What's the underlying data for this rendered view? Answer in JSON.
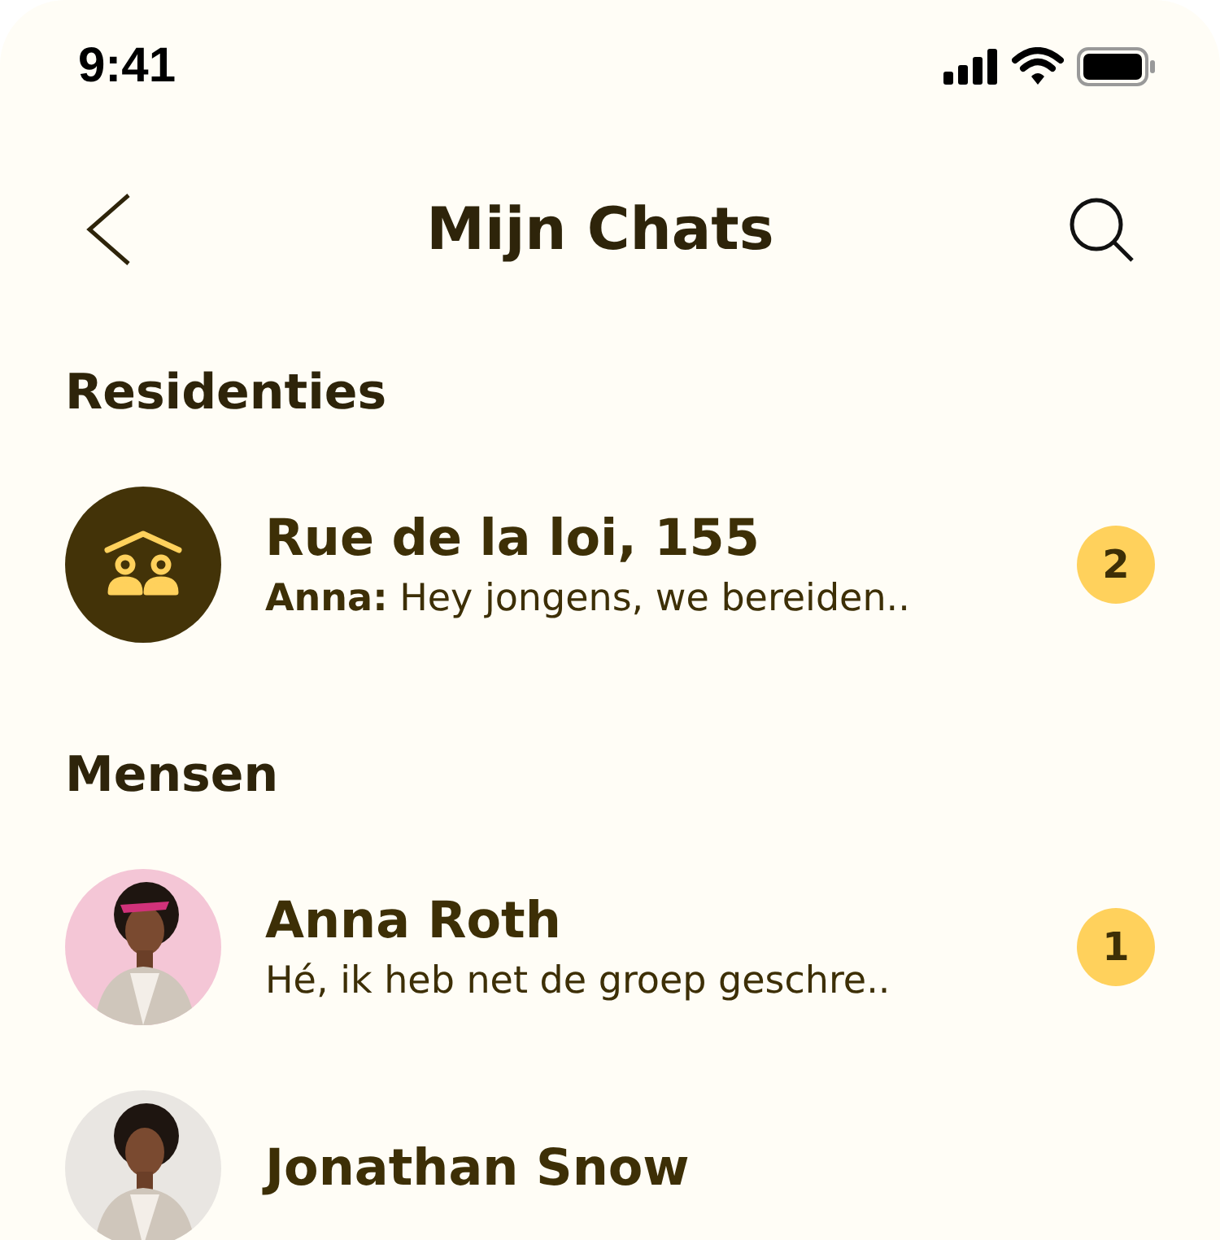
{
  "status_bar": {
    "time": "9:41"
  },
  "header": {
    "title": "Mijn Chats"
  },
  "sections": [
    {
      "title": "Residenties",
      "chats": [
        {
          "avatar": {
            "kind": "group"
          },
          "name": "Rue de la loi, 155",
          "preview": "**Anna:** Hey jongens, we bereiden..",
          "unread": "2"
        }
      ]
    },
    {
      "title": "Mensen",
      "chats": [
        {
          "name": "Anna Roth",
          "preview": "Hé, ik heb net de groep geschre..",
          "unread": "1"
        },
        {
          "name": "Jonathan Snow"
        }
      ]
    }
  ]
}
